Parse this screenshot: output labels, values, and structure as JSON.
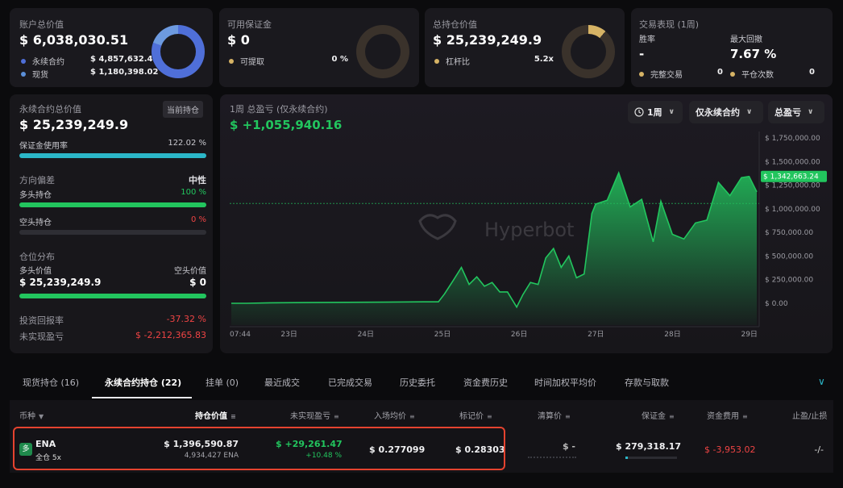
{
  "colors": {
    "accent_green": "#22c55e",
    "loss_red": "#ef4444",
    "bar_cyan": "#2bb7c8",
    "donut_blue": "#4f6fd8",
    "donut_light": "#5b8fd8",
    "gold": "#d6b365"
  },
  "cards": {
    "account": {
      "title": "账户总价值",
      "value": "$ 6,038,030.51",
      "rows": [
        {
          "label": "永续合约",
          "value": "$ 4,857,632.49",
          "color": "#4f6fd8"
        },
        {
          "label": "现货",
          "value": "$ 1,180,398.02",
          "color": "#5b8fd8"
        }
      ]
    },
    "margin": {
      "title": "可用保证金",
      "value": "$ 0",
      "rows": [
        {
          "label": "可提取",
          "value": "0 %",
          "color": "#d6b365"
        }
      ]
    },
    "position": {
      "title": "总持仓价值",
      "value": "$ 25,239,249.9",
      "rows": [
        {
          "label": "杠杆比",
          "value": "5.2x",
          "color": "#d6b365"
        }
      ]
    },
    "performance": {
      "title": "交易表现 (1周)",
      "win_rate_label": "胜率",
      "win_rate_value": "-",
      "max_drawdown_label": "最大回撤",
      "max_drawdown_value": "7.67 %",
      "rows": [
        {
          "label": "完整交易",
          "value": "0",
          "color": "#d6b365"
        },
        {
          "label": "平仓次数",
          "value": "0",
          "color": "#d6b365"
        }
      ]
    }
  },
  "left_panel": {
    "title": "永续合约总价值",
    "tag": "当前持仓",
    "value": "$ 25,239,249.9",
    "margin_usage_label": "保证金使用率",
    "margin_usage_value": "122.02 %",
    "margin_usage_fill": 1.0,
    "bias_label": "方向偏差",
    "bias_value": "中性",
    "long_label": "多头持仓",
    "long_value": "100 %",
    "long_fill": 1.0,
    "short_label": "空头持仓",
    "short_value": "0 %",
    "short_fill": 0.0,
    "dist_label": "仓位分布",
    "dist_long_label": "多头价值",
    "dist_short_label": "空头价值",
    "dist_long_value": "$ 25,239,249.9",
    "dist_short_value": "$ 0",
    "roi_label": "投资回报率",
    "roi_value": "-37.32 %",
    "upnl_label": "未实现盈亏",
    "upnl_value": "$ -2,212,365.83"
  },
  "chart_panel": {
    "title": "1周 总盈亏 (仅永续合约)",
    "value": "$ +1,055,940.16",
    "dropdowns": [
      {
        "label": "1周",
        "icon": "clock-icon"
      },
      {
        "label": "仅永续合约"
      },
      {
        "label": "总盈亏"
      }
    ],
    "watermark": "Hyperbot",
    "last_label": "$ 1,342,663.24"
  },
  "chart_data": {
    "type": "area",
    "ylim": [
      -250000,
      1750000
    ],
    "yticks": [
      "$ 1,750,000.00",
      "$ 1,500,000.00",
      "$ 1,250,000.00",
      "$ 1,000,000.00",
      "$ 750,000.00",
      "$ 500,000.00",
      "$ 250,000.00",
      "$ 0.00"
    ],
    "ytick_values": [
      1750000,
      1500000,
      1250000,
      1000000,
      750000,
      500000,
      250000,
      0
    ],
    "xticks": [
      "07:44",
      "23日",
      "24日",
      "25日",
      "26日",
      "27日",
      "28日",
      "29日"
    ],
    "xtick_values": [
      0,
      0.75,
      1.75,
      2.75,
      3.75,
      4.75,
      5.75,
      6.75
    ],
    "baseline": 1055940.16,
    "x": [
      0,
      0.2,
      0.5,
      1.0,
      1.5,
      2.0,
      2.5,
      2.7,
      2.78,
      2.9,
      3.0,
      3.1,
      3.2,
      3.3,
      3.4,
      3.5,
      3.6,
      3.72,
      3.8,
      3.9,
      4.0,
      4.1,
      4.2,
      4.3,
      4.4,
      4.5,
      4.6,
      4.7,
      4.75,
      4.9,
      5.05,
      5.2,
      5.35,
      5.5,
      5.6,
      5.75,
      5.9,
      6.05,
      6.2,
      6.35,
      6.5,
      6.65,
      6.75,
      6.85
    ],
    "y": [
      0,
      0,
      5000,
      8000,
      10000,
      12000,
      15000,
      15000,
      100000,
      250000,
      380000,
      200000,
      280000,
      180000,
      220000,
      120000,
      120000,
      -40000,
      90000,
      220000,
      200000,
      480000,
      580000,
      380000,
      500000,
      270000,
      310000,
      950000,
      1050000,
      1090000,
      1380000,
      1020000,
      1100000,
      650000,
      1080000,
      730000,
      680000,
      850000,
      880000,
      1280000,
      1140000,
      1330000,
      1342663,
      1180000
    ]
  },
  "tabs": [
    "现货持仓 (16)",
    "永续合约持仓 (22)",
    "挂单 (0)",
    "最近成交",
    "已完成交易",
    "历史委托",
    "资金费历史",
    "时间加权平均价",
    "存款与取款"
  ],
  "active_tab": 1,
  "table": {
    "headers": [
      "币种",
      "持仓价值",
      "未实现盈亏",
      "入场均价",
      "标记价",
      "清算价",
      "保证金",
      "资金费用",
      "止盈/止损"
    ],
    "row": {
      "coin": "ENA",
      "coin_sub": "全仓 5x",
      "coin_badge": "多",
      "value": "$ 1,396,590.87",
      "value_sub": "4,934,427 ENA",
      "upnl": "$ +29,261.47",
      "upnl_pct": "+10.48 %",
      "entry": "$ 0.277099",
      "mark": "$ 0.28303",
      "liq": "$ -",
      "margin": "$ 279,318.17",
      "margin_fill": 0.04,
      "funding": "$ -3,953.02",
      "tpsl": "-/-"
    }
  }
}
